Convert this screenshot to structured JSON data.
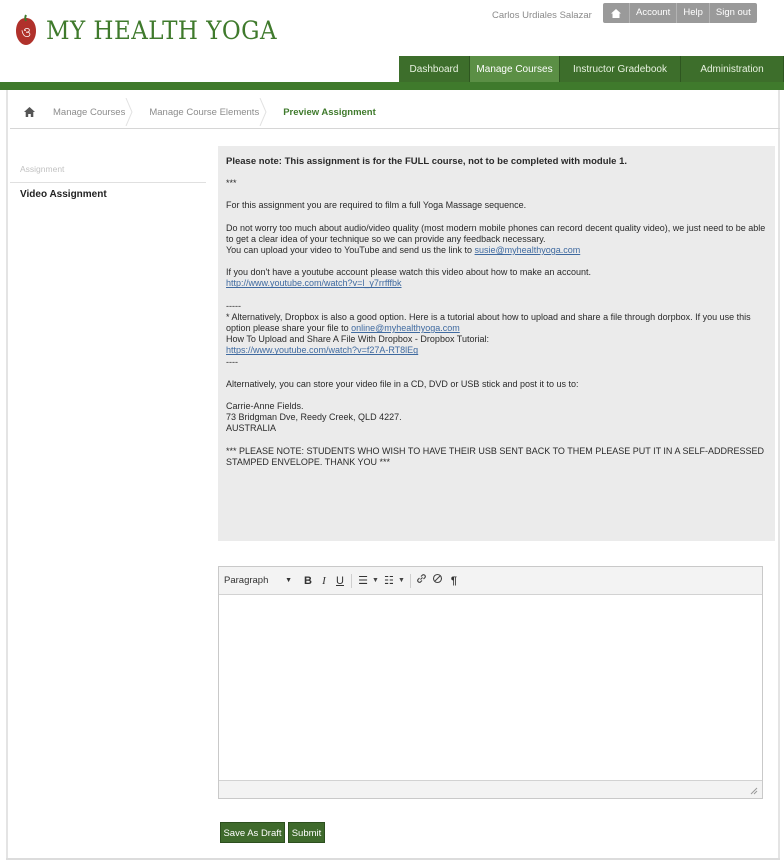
{
  "header": {
    "logo_text": "MY HEALTH YOGA",
    "user_name": "Carlos Urdiales Salazar",
    "top_links": {
      "account": "Account",
      "help": "Help",
      "sign_out": "Sign out"
    },
    "icons": {
      "logo": "logo-mark",
      "home": "home-icon"
    }
  },
  "nav": {
    "tabs": [
      {
        "label": "Dashboard",
        "active": false
      },
      {
        "label": "Manage Courses",
        "active": true
      },
      {
        "label": "Instructor Gradebook",
        "active": false
      },
      {
        "label": "Administration",
        "active": false
      }
    ]
  },
  "breadcrumb": {
    "items": [
      "Manage Courses",
      "Manage Course Elements",
      "Preview Assignment"
    ]
  },
  "sidebar": {
    "heading": "Assignment",
    "item": "Video Assignment"
  },
  "instructions": {
    "note": "Please note: This assignment is for the FULL course, not to be completed with module 1.",
    "stars": "***",
    "para1": "For this assignment you are required to film a full Yoga Massage sequence.",
    "para2_a": "Do not worry too much about audio/video quality (most modern mobile phones can record decent quality video), we just need to be able to get a clear idea of your technique so we can provide any feedback necessary.",
    "para2_b": "You can upload your video to YouTube and send us the link to ",
    "email1": "susie@myhealthyoga.com",
    "para3": "If you don't have a youtube account please watch this video about how to make an account.",
    "link_youtube": "http://www.youtube.com/watch?v=l_y7rrfffbk",
    "dashes1": "-----",
    "para4_a": " * Alternatively, Dropbox is also a good option. Here is a tutorial about how to upload and share a file through dorpbox. If you use this option please share your file to ",
    "email2": "online@myhealthyoga.com",
    "para4_b": "How To Upload and Share A File With Dropbox - Dropbox Tutorial:",
    "link_dropbox": "https://www.youtube.com/watch?v=f27A-RT8lEg",
    "dashes2": "----",
    "para5": "Alternatively, you can store your video file in a CD, DVD or USB stick and post it to us to:",
    "addr1": "Carrie-Anne Fields.",
    "addr2": "73 Bridgman Dve, Reedy Creek, QLD 4227.",
    "addr3": "AUSTRALIA",
    "para6": "*** PLEASE NOTE: STUDENTS WHO WISH TO HAVE THEIR USB SENT BACK TO THEM PLEASE PUT IT IN A SELF-ADDRESSED STAMPED ENVELOPE. THANK YOU ***"
  },
  "editor": {
    "format_value": "Paragraph",
    "toolbar": {
      "bold": "B",
      "italic": "I",
      "underline": "U",
      "bullet_list": "☰",
      "numbered_list": "☷",
      "link": "🔗",
      "unlink": "⊘",
      "paragraph_mark": "¶"
    }
  },
  "actions": {
    "save_draft": "Save As Draft",
    "submit": "Submit"
  },
  "colors": {
    "brand_green": "#3f7a2c",
    "nav_dark": "#3d6e2b",
    "nav_active": "#5b8f45",
    "button_green": "#3f6a2c",
    "panel_gray": "#ebebeb"
  }
}
